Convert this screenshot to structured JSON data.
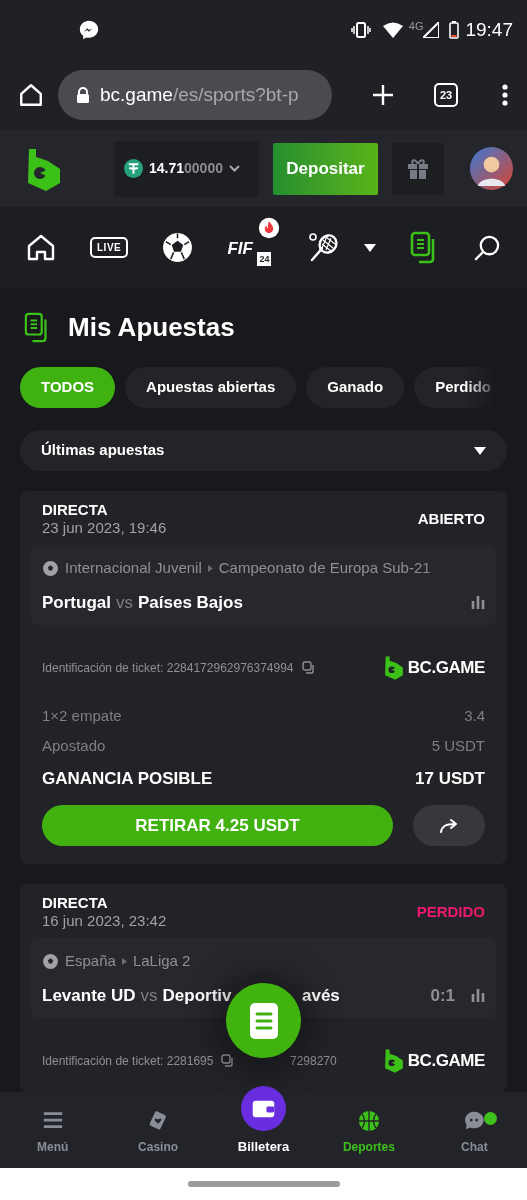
{
  "status_bar": {
    "network": "4G",
    "time": "19:47"
  },
  "browser": {
    "url_host": "bc.game",
    "url_path": "/es/sports?bt-p",
    "tab_count": "23"
  },
  "header": {
    "balance_main": "14.71",
    "balance_rest": "00000",
    "deposit_button": "Depositar"
  },
  "sports_nav": [
    {
      "kind": "home",
      "selected": false
    },
    {
      "kind": "live",
      "label": "LIVE",
      "selected": false
    },
    {
      "kind": "soccer",
      "selected": false
    },
    {
      "kind": "fifa",
      "label": "FIF",
      "badge": "24",
      "selected": false
    },
    {
      "kind": "tennis",
      "selected": false
    },
    {
      "kind": "more",
      "selected": false
    },
    {
      "kind": "bets",
      "selected": true
    },
    {
      "kind": "search",
      "selected": false
    }
  ],
  "page_title": "Mis Apuestas",
  "filter_tabs": [
    {
      "label": "TODOS",
      "selected": true
    },
    {
      "label": "Apuestas abiertas",
      "selected": false
    },
    {
      "label": "Ganado",
      "selected": false
    },
    {
      "label": "Perdido",
      "selected": false
    }
  ],
  "sort_dropdown": {
    "value": "Últimas apuestas"
  },
  "bets": [
    {
      "type": "DIRECTA",
      "date": "23 jun 2023, 19:46",
      "status": "ABIERTO",
      "kind": "open",
      "league": [
        "Internacional Juvenil",
        "Campeonato de Europa Sub-21"
      ],
      "home": "Portugal",
      "vs": "vs",
      "away": [
        "Países Bajos"
      ],
      "ticket": [
        "Identificación de ticket: 2284172962976374994"
      ],
      "brand": "BC.GAME",
      "market": "1×2 empate",
      "odds": "3.4",
      "staked_label": "Apostado",
      "staked": "5 USDT",
      "win_label": "GANANCIA POSIBLE",
      "win": "17 USDT",
      "cashout": "RETIRAR 4.25 USDT"
    },
    {
      "type": "DIRECTA",
      "date": "16 jun 2023, 23:42",
      "status": "PERDIDO",
      "kind": "lost",
      "league": [
        "España",
        "LaLiga 2"
      ],
      "home": "Levante UD",
      "vs": "vs",
      "away": [
        "Deportiv",
        "avés"
      ],
      "score": "0:1",
      "ticket": [
        "Identificación de ticket: 2281695",
        "7298270"
      ],
      "brand": "BC.GAME"
    }
  ],
  "bottom_nav": [
    {
      "label": "Menú",
      "kind": "tab",
      "selected": false,
      "notification": false
    },
    {
      "label": "Casino",
      "kind": "tab",
      "selected": false,
      "notification": false
    },
    {
      "label": "Billetera",
      "kind": "center",
      "selected": false,
      "notification": false
    },
    {
      "label": "Deportes",
      "kind": "tab",
      "selected": true,
      "notification": false
    },
    {
      "label": "Chat",
      "kind": "tab",
      "selected": false,
      "notification": true
    }
  ]
}
